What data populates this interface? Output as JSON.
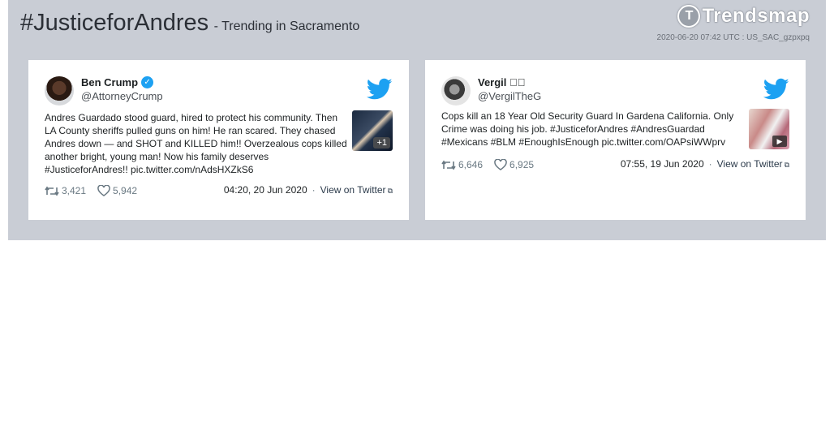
{
  "header": {
    "hashtag": "#JusticeforAndres",
    "subtitle": "- Trending in Sacramento",
    "logo_text": "Trendsmap",
    "meta": "2020-06-20 07:42 UTC : US_SAC_gzpxpq"
  },
  "tweets": [
    {
      "name": "Ben Crump",
      "verified": true,
      "handle": "@AttorneyCrump",
      "text": "Andres Guardado stood guard, hired to protect his community. Then LA County sheriffs pulled guns on him! He ran scared. They chased Andres down — and SHOT and KILLED him!! Overzealous cops killed another bright, young man! Now his family deserves #JusticeforAndres!! pic.twitter.com/nAdsHXZkS6",
      "media_badge": "+1",
      "retweets": "3,421",
      "likes": "5,942",
      "time": "04:20, 20 Jun 2020",
      "view_label": "View on Twitter"
    },
    {
      "name": "Vergil \u0000\u0000",
      "verified": false,
      "handle": "@VergilTheG",
      "text": "Cops kill an 18 Year Old Security Guard In Gardena California. Only Crime was doing his job. #JusticeforAndres #AndresGuardad #Mexicans #BLM #EnoughIsEnough pic.twitter.com/OAPsiWWprv",
      "media_badge": "video",
      "retweets": "6,646",
      "likes": "6,925",
      "time": "07:55, 19 Jun 2020",
      "view_label": "View on Twitter"
    }
  ],
  "colors": {
    "banner": "#c9cdd5",
    "twitter_blue": "#1da1f2",
    "stat_gray": "#697882"
  }
}
